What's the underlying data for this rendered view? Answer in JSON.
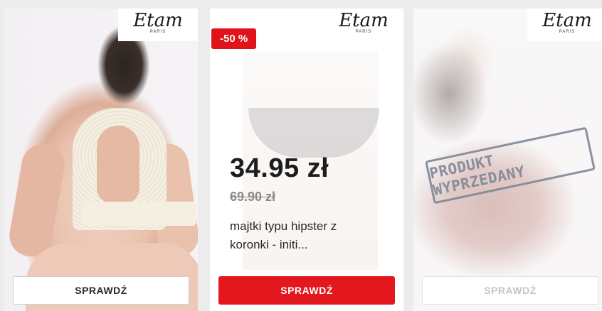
{
  "brand": {
    "name": "Etam",
    "tagline": "PARIS"
  },
  "cards": [
    {
      "button_label": "SPRAWDŹ",
      "image_icon": "lingerie-back-photo"
    },
    {
      "discount_badge": "-50 %",
      "price": "34.95 zł",
      "old_price": "69.90 zł",
      "product_name": "majtki typu hipster z koronki - initi...",
      "button_label": "SPRAWDŹ",
      "image_icon": "hipster-panties-photo",
      "accent_color": "#e3181f"
    },
    {
      "sold_out_stamp": "PRODUKT WYPRZEDANY",
      "button_label": "SPRAWDŹ",
      "image_icon": "lace-bra-photo"
    }
  ]
}
